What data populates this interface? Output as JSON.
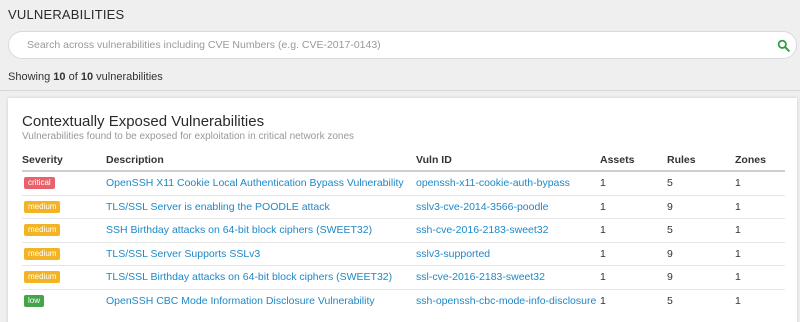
{
  "page": {
    "title": "VULNERABILITIES"
  },
  "search": {
    "placeholder": "Search across vulnerabilities including CVE Numbers (e.g. CVE-2017-0143)",
    "value": ""
  },
  "summary": {
    "prefix": "Showing",
    "shown": "10",
    "of": "of",
    "total": "10",
    "suffix": "vulnerabilities"
  },
  "card": {
    "title": "Contextually Exposed Vulnerabilities",
    "subtitle": "Vulnerabilities found to be exposed for exploitation in critical network zones"
  },
  "table": {
    "columns": {
      "severity": "Severity",
      "description": "Description",
      "vuln_id": "Vuln ID",
      "assets": "Assets",
      "rules": "Rules",
      "zones": "Zones"
    },
    "rows": [
      {
        "severity": "critical",
        "description": "OpenSSH X11 Cookie Local Authentication Bypass Vulnerability",
        "vuln_id": "openssh-x11-cookie-auth-bypass",
        "assets": "1",
        "rules": "5",
        "zones": "1"
      },
      {
        "severity": "medium",
        "description": "TLS/SSL Server is enabling the POODLE attack",
        "vuln_id": "sslv3-cve-2014-3566-poodle",
        "assets": "1",
        "rules": "9",
        "zones": "1"
      },
      {
        "severity": "medium",
        "description": "SSH Birthday attacks on 64-bit block ciphers (SWEET32)",
        "vuln_id": "ssh-cve-2016-2183-sweet32",
        "assets": "1",
        "rules": "5",
        "zones": "1"
      },
      {
        "severity": "medium",
        "description": "TLS/SSL Server Supports SSLv3",
        "vuln_id": "sslv3-supported",
        "assets": "1",
        "rules": "9",
        "zones": "1"
      },
      {
        "severity": "medium",
        "description": "TLS/SSL Birthday attacks on 64-bit block ciphers (SWEET32)",
        "vuln_id": "ssl-cve-2016-2183-sweet32",
        "assets": "1",
        "rules": "9",
        "zones": "1"
      },
      {
        "severity": "low",
        "description": "OpenSSH CBC Mode Information Disclosure Vulnerability",
        "vuln_id": "ssh-openssh-cbc-mode-info-disclosure",
        "assets": "1",
        "rules": "5",
        "zones": "1"
      }
    ]
  },
  "colors": {
    "critical": "#e8616b",
    "medium": "#f2b325",
    "low": "#43a548",
    "link": "#1e88c8",
    "search_icon": "#2e9e3e"
  },
  "icons": {
    "search": "search-icon"
  }
}
